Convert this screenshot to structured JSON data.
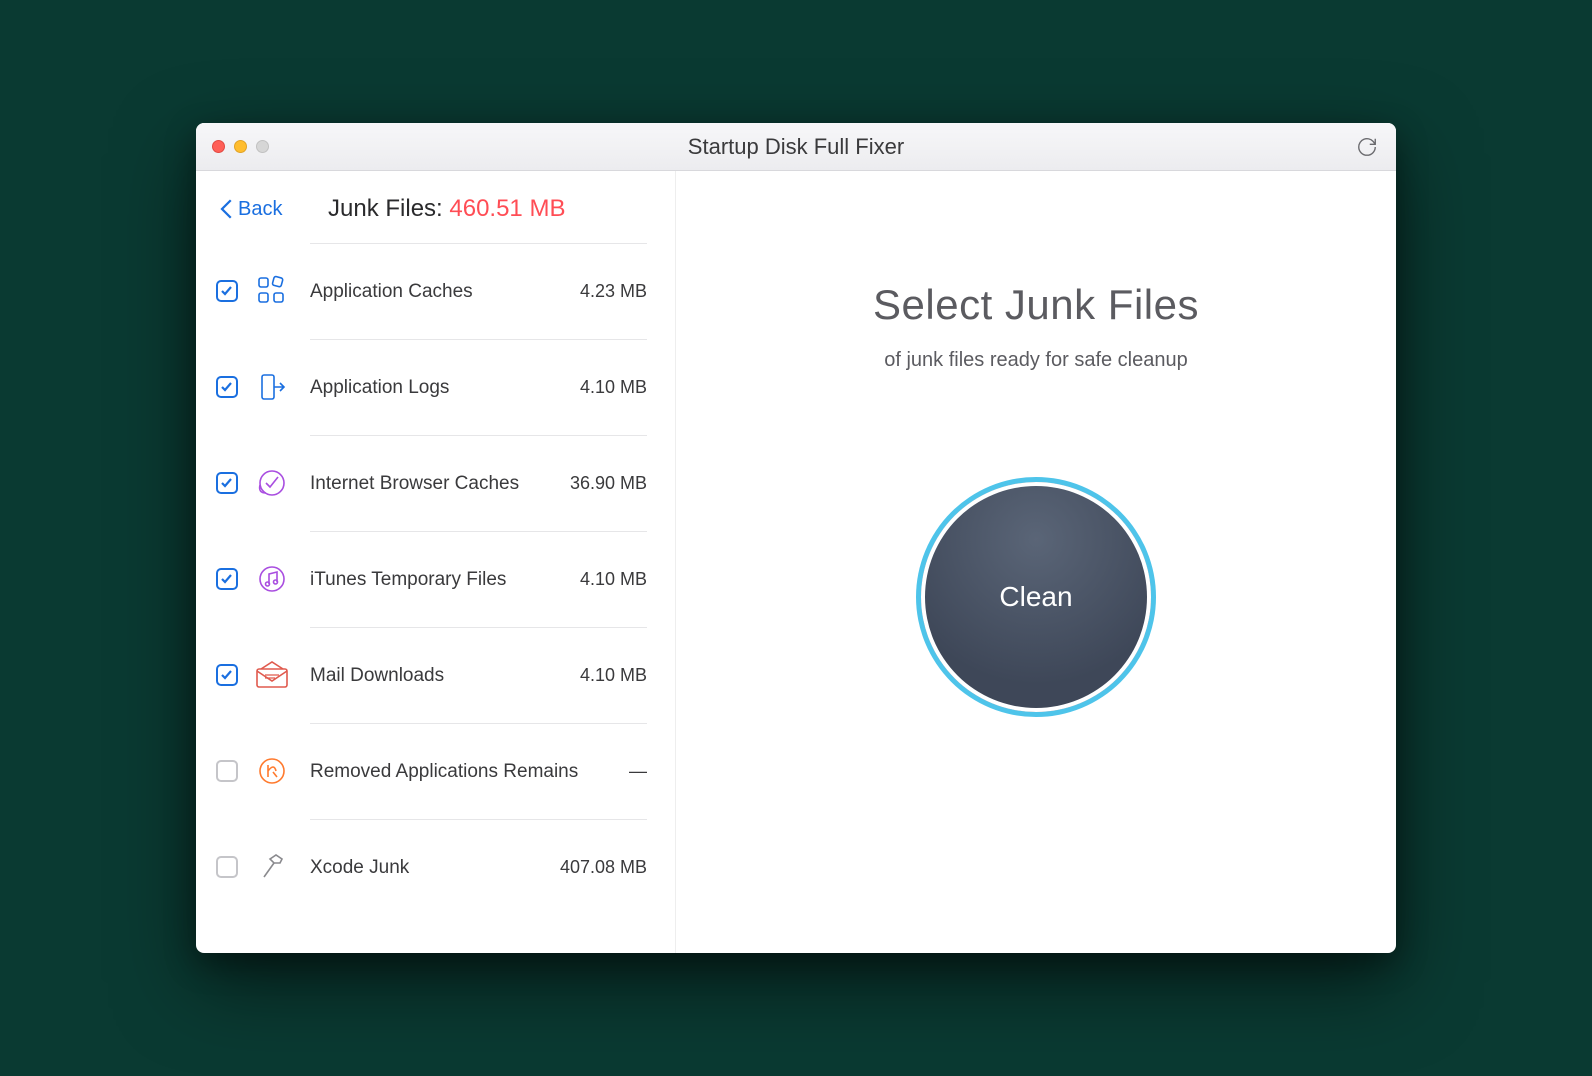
{
  "window": {
    "title_prefix": "Startup Disk Full ",
    "title_bold": "Fixer"
  },
  "sidebar": {
    "back_label": "Back",
    "junk_label": "Junk Files: ",
    "junk_size": "460.51 MB",
    "items": [
      {
        "label": "Application Caches",
        "size": "4.23 MB",
        "checked": true,
        "icon": "apps-icon",
        "color": "#1a6fe0"
      },
      {
        "label": "Application Logs",
        "size": "4.10 MB",
        "checked": true,
        "icon": "log-icon",
        "color": "#1a6fe0"
      },
      {
        "label": "Internet Browser Caches",
        "size": "36.90 MB",
        "checked": true,
        "icon": "browser-cache-icon",
        "color": "#a94ee0"
      },
      {
        "label": "iTunes Temporary Files",
        "size": "4.10 MB",
        "checked": true,
        "icon": "itunes-icon",
        "color": "#a94ee0"
      },
      {
        "label": "Mail Downloads",
        "size": "4.10 MB",
        "checked": true,
        "icon": "mail-icon",
        "color": "#e05a4e"
      },
      {
        "label": "Removed Applications Remains",
        "size": "—",
        "checked": false,
        "icon": "removed-app-icon",
        "color": "#ff7a2e"
      },
      {
        "label": "Xcode Junk",
        "size": "407.08 MB",
        "checked": false,
        "icon": "hammer-icon",
        "color": "#8a8a8e"
      }
    ]
  },
  "main": {
    "title": "Select Junk Files",
    "subtitle": "of junk files ready for safe cleanup",
    "clean_label": "Clean"
  }
}
